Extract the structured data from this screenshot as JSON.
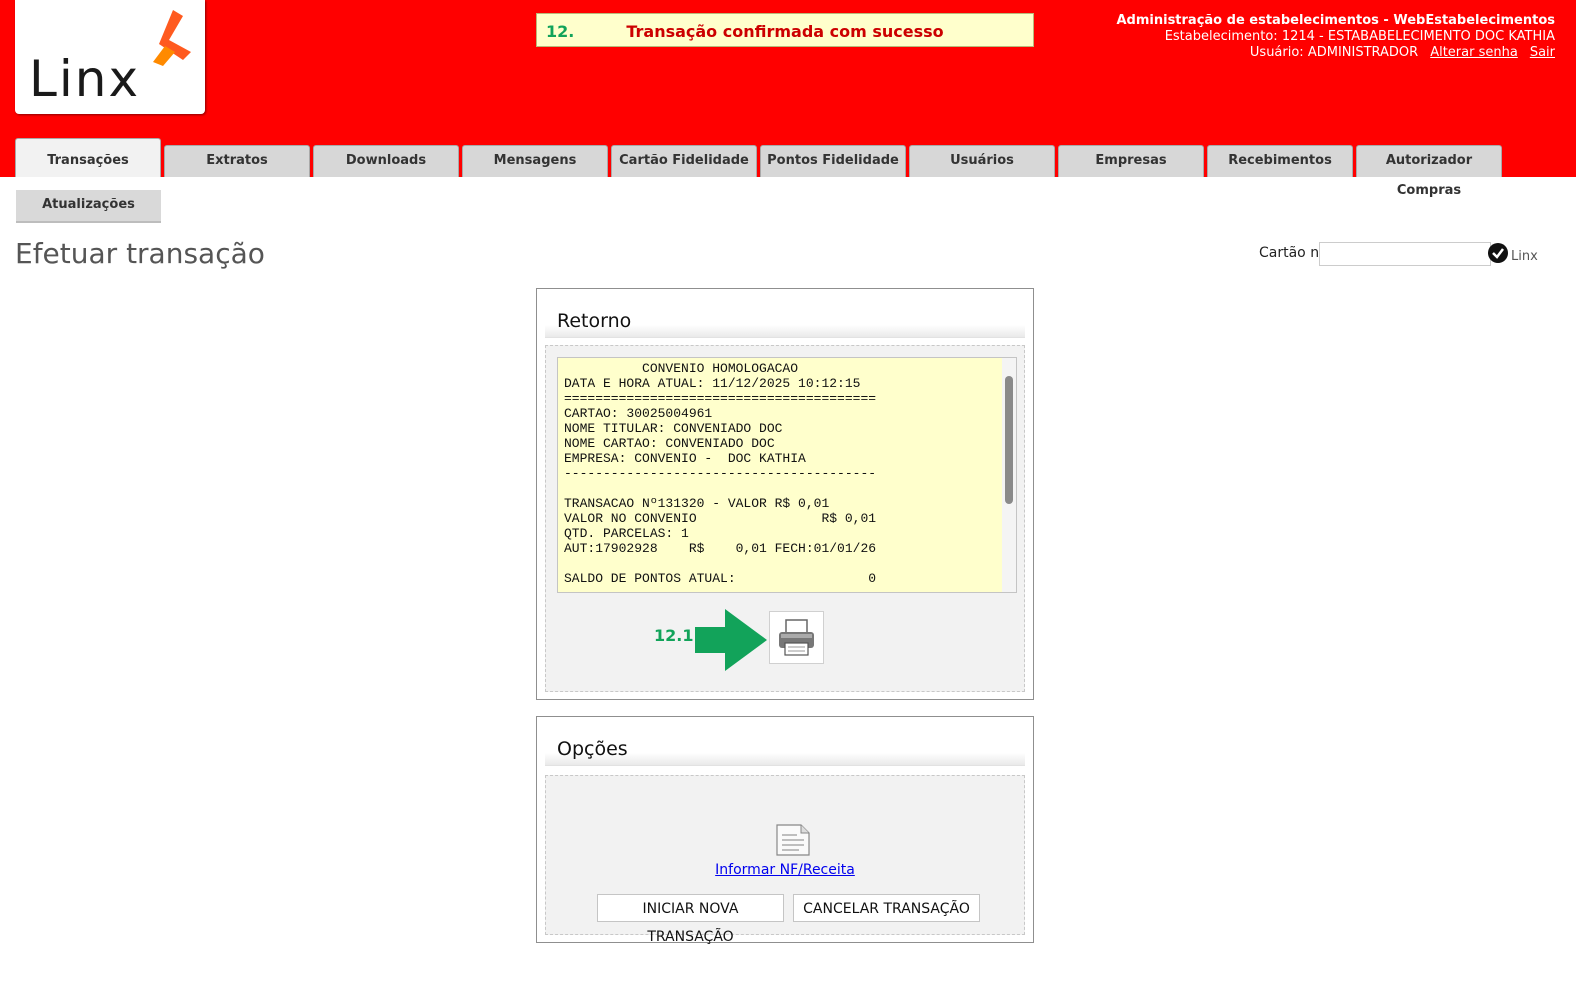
{
  "logo": {
    "text": "Linx"
  },
  "notice": {
    "step": "12.",
    "message": "Transação confirmada com sucesso"
  },
  "admin": {
    "title": "Administração de estabelecimentos - WebEstabelecimentos",
    "establishment": "Estabelecimento: 1214 - ESTABABELECIMENTO DOC KATHIA",
    "user": "Usuário: ADMINISTRADOR",
    "change_password": "Alterar senha",
    "logout": "Sair"
  },
  "tabs": [
    "Transações",
    "Extratos",
    "Downloads",
    "Mensagens",
    "Cartão Fidelidade",
    "Pontos Fidelidade",
    "Usuários",
    "Empresas",
    "Recebimentos",
    "Autorizador Compras"
  ],
  "subtab": "Atualizações",
  "page_title": "Efetuar transação",
  "card_search": {
    "label": "Cartão nº",
    "value": "",
    "brand": "Linx"
  },
  "retorno": {
    "title": "Retorno",
    "receipt": "          CONVENIO HOMOLOGACAO\nDATA E HORA ATUAL: 11/12/2025 10:12:15\n========================================\nCARTAO: 30025004961\nNOME TITULAR: CONVENIADO DOC\nNOME CARTAO: CONVENIADO DOC\nEMPRESA: CONVENIO -  DOC KATHIA\n----------------------------------------\n\nTRANSACAO Nº131320 - VALOR R$ 0,01\nVALOR NO CONVENIO                R$ 0,01\nQTD. PARCELAS: 1\nAUT:17902928    R$    0,01 FECH:01/01/26\n\nSALDO DE PONTOS ATUAL:                 0",
    "step_label": "12.1."
  },
  "opcoes": {
    "title": "Opções",
    "nf_link": "Informar NF/Receita",
    "new_button": "INICIAR NOVA TRANSAÇÃO",
    "cancel_button": "CANCELAR TRANSAÇÃO"
  },
  "colors": {
    "header_bg": "#ff0000",
    "notice_bg": "#ffffcc",
    "notice_text": "#cc0000",
    "step_green": "#12a35a",
    "receipt_bg": "#ffffcc"
  }
}
